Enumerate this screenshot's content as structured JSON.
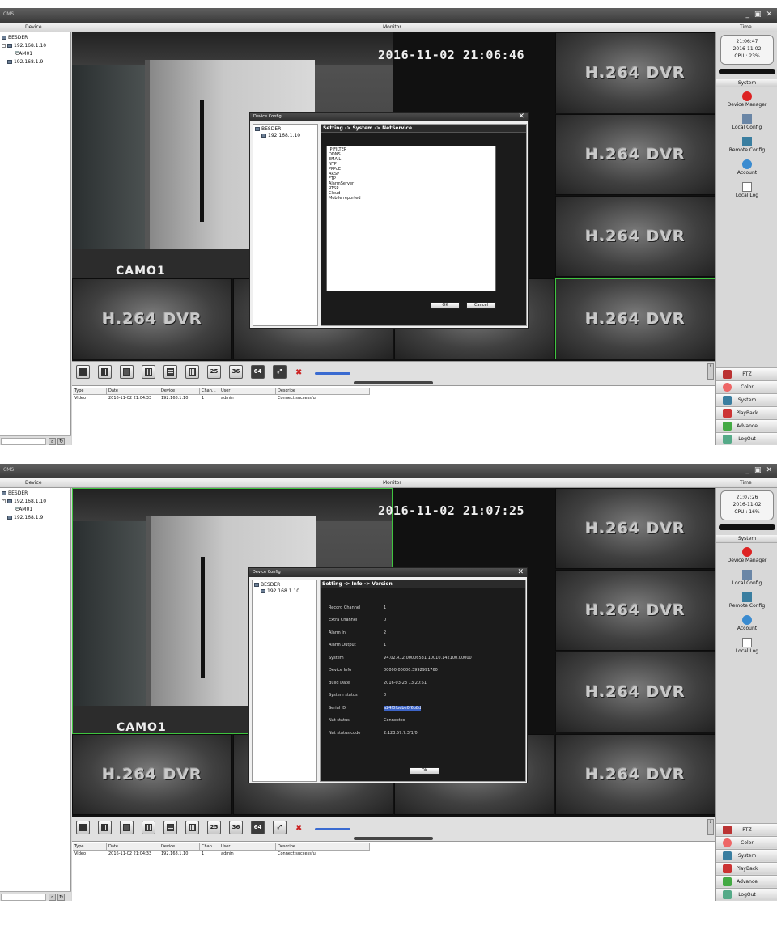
{
  "shots": [
    {
      "titlebar": {
        "app": "CMS",
        "min": "_",
        "max": "▣",
        "close": "✕"
      },
      "header": {
        "device": "Device",
        "monitor": "Monitor",
        "time": "Time"
      },
      "tree": {
        "root": "BESDER",
        "device1": "192.168.1.10",
        "cam": "CAM01",
        "device2": "192.168.1.9"
      },
      "camera": {
        "timestamp": "2016-11-02 21:06:46",
        "name": "CAMO1"
      },
      "watermark": "H.264 DVR",
      "clock": {
        "time": "21:06:47",
        "date": "2016-11-02",
        "cpu": "CPU : 23%"
      },
      "system": {
        "header": "System",
        "items": [
          "Device Manager",
          "Local Config",
          "Remote Config",
          "Account",
          "Local Log"
        ]
      },
      "nav": [
        "PTZ",
        "Color",
        "System",
        "PlayBack",
        "Advance",
        "LogOut"
      ],
      "toolbar": {
        "layouts": [
          "25",
          "36",
          "64"
        ]
      },
      "log": {
        "columns": [
          "Type",
          "Date",
          "Device",
          "Chan...",
          "User",
          "Describe"
        ],
        "row": [
          "Video",
          "2016-11-02 21:04:33",
          "192.168.1.10",
          "1",
          "admin",
          "Connect successful"
        ]
      },
      "dialog": {
        "title": "Device Config",
        "tree_root": "BESDER",
        "tree_device": "192.168.1.10",
        "path": "Setting -> System -> NetService",
        "services": [
          "IP FILTER",
          "DDNS",
          "EMAIL",
          "NTP",
          "PPPoE",
          "ARSP",
          "FTP",
          "AlarmServer",
          "RTSP",
          "Cloud",
          "Mobile reported"
        ],
        "ok": "OK",
        "cancel": "Cancel"
      }
    },
    {
      "titlebar": {
        "app": "CMS",
        "min": "_",
        "max": "▣",
        "close": "✕"
      },
      "header": {
        "device": "Device",
        "monitor": "Monitor",
        "time": "Time"
      },
      "tree": {
        "root": "BESDER",
        "device1": "192.168.1.10",
        "cam": "CAM01",
        "device2": "192.168.1.9"
      },
      "camera": {
        "timestamp": "2016-11-02 21:07:25",
        "name": "CAMO1"
      },
      "watermark": "H.264 DVR",
      "clock": {
        "time": "21:07:26",
        "date": "2016-11-02",
        "cpu": "CPU : 16%"
      },
      "system": {
        "header": "System",
        "items": [
          "Device Manager",
          "Local Config",
          "Remote Config",
          "Account",
          "Local Log"
        ]
      },
      "nav": [
        "PTZ",
        "Color",
        "System",
        "PlayBack",
        "Advance",
        "LogOut"
      ],
      "toolbar": {
        "layouts": [
          "25",
          "36",
          "64"
        ]
      },
      "log": {
        "columns": [
          "Type",
          "Date",
          "Device",
          "Chan...",
          "User",
          "Describe"
        ],
        "row": [
          "Video",
          "2016-11-02 21:04:33",
          "192.168.1.10",
          "1",
          "admin",
          "Connect successful"
        ]
      },
      "dialog": {
        "title": "Device Config",
        "tree_root": "BESDER",
        "tree_device": "192.168.1.10",
        "path": "Setting -> Info -> Version",
        "info": [
          {
            "label": "Record Channel",
            "value": "1"
          },
          {
            "label": "Extra Channel",
            "value": "0"
          },
          {
            "label": "Alarm In",
            "value": "2"
          },
          {
            "label": "Alarm Output",
            "value": "1"
          },
          {
            "label": "System",
            "value": "V4.02.R12.00006531.10010.142100.00000"
          },
          {
            "label": "Device Info",
            "value": "00000.00000.3992991760"
          },
          {
            "label": "Build Date",
            "value": "2016-03-23 13:20:51"
          },
          {
            "label": "System status",
            "value": "0"
          },
          {
            "label": "Serial ID",
            "value": "a24f0fbebe0f6b8d"
          },
          {
            "label": "Nat status",
            "value": "Connected"
          },
          {
            "label": "Nat status code",
            "value": "2:123.57.7.3/1/0"
          }
        ],
        "ok": "OK"
      }
    }
  ]
}
